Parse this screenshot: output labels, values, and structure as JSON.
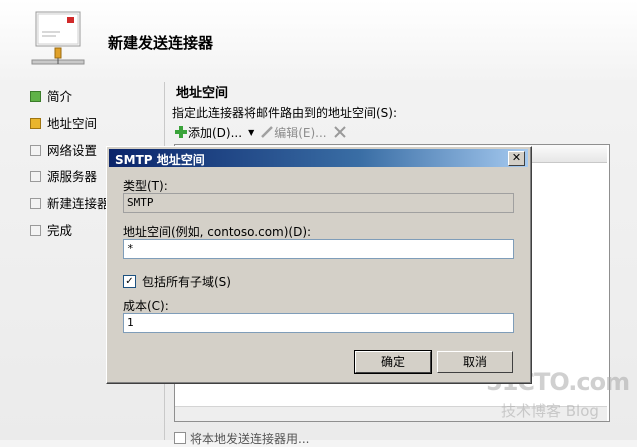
{
  "wizard": {
    "title": "新建发送连接器"
  },
  "nav": {
    "items": [
      {
        "label": "简介",
        "status": "completed",
        "color": "#5fb247"
      },
      {
        "label": "地址空间",
        "status": "current",
        "color": "#e9b52c"
      },
      {
        "label": "网络设置",
        "status": "pending"
      },
      {
        "label": "源服务器",
        "status": "pending"
      },
      {
        "label": "新建连接器",
        "status": "pending"
      },
      {
        "label": "完成",
        "status": "pending"
      }
    ]
  },
  "main": {
    "section_title": "地址空间",
    "description": "指定此连接器将邮件路由到的地址空间(S):",
    "toolbar": {
      "add_label": "添加(D)...",
      "edit_label": "编辑(E)...",
      "add_icon": "plus-icon",
      "edit_icon": "pencil-icon",
      "delete_icon": "delete-x-icon"
    },
    "bottom_option": "将本地发送连接器用..."
  },
  "dialog": {
    "title": "SMTP 地址空间",
    "type_label": "类型(T):",
    "type_value": "SMTP",
    "address_label": "地址空间(例如, contoso.com)(D):",
    "address_value": "*",
    "include_subdomains_label": "包括所有子域(S)",
    "include_subdomains_checked": true,
    "cost_label": "成本(C):",
    "cost_value": "1",
    "ok_label": "确定",
    "cancel_label": "取消",
    "close_glyph": "✕"
  },
  "watermark": {
    "site": "51CTO.com",
    "subtitle": "技术博客 Blog"
  },
  "colors": {
    "titlebar_start": "#0a246a",
    "titlebar_end": "#a6caf0",
    "dialog_bg": "#d4d0c8"
  }
}
